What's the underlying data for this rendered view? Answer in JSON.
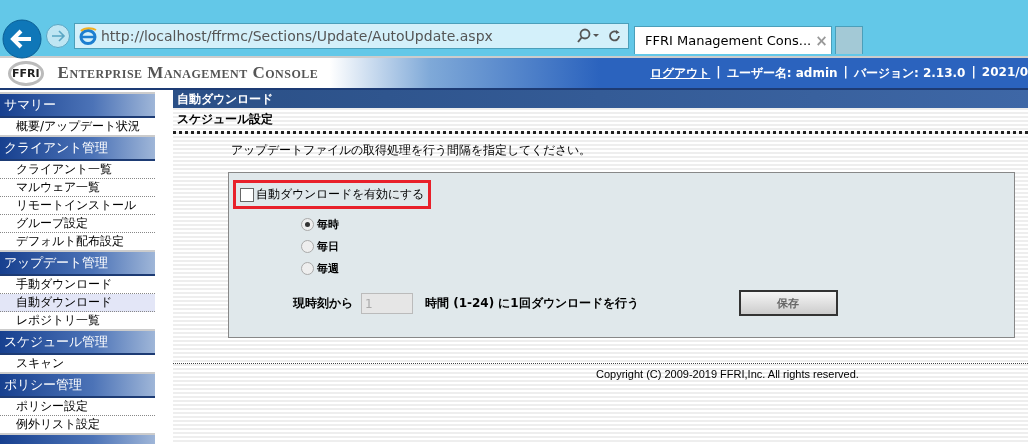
{
  "browser": {
    "url": "http://localhost/ffrmc/Sections/Update/AutoUpdate.aspx",
    "tab_title": "FFRI Management Cons...",
    "tab_close": "×"
  },
  "header": {
    "logo": "FFRI",
    "title": "Enterprise Management Console",
    "links": [
      {
        "text": "ログアウト",
        "kind": "link"
      },
      {
        "text": "|",
        "kind": "sep"
      },
      {
        "text": "ユーザー名: admin",
        "kind": "text"
      },
      {
        "text": "|",
        "kind": "sep"
      },
      {
        "text": "バージョン: 2.13.0",
        "kind": "text"
      },
      {
        "text": "|",
        "kind": "sep"
      },
      {
        "text": "2021/0",
        "kind": "text"
      }
    ]
  },
  "sidebar": {
    "sections": [
      {
        "title": "サマリー",
        "items": [
          {
            "label": "概要/アップデート状況",
            "selected": false
          }
        ]
      },
      {
        "title": "クライアント管理",
        "items": [
          {
            "label": "クライアント一覧",
            "selected": false
          },
          {
            "label": "マルウェア一覧",
            "selected": false
          },
          {
            "label": "リモートインストール",
            "selected": false
          },
          {
            "label": "グループ設定",
            "selected": false
          },
          {
            "label": "デフォルト配布設定",
            "selected": false
          }
        ]
      },
      {
        "title": "アップデート管理",
        "items": [
          {
            "label": "手動ダウンロード",
            "selected": false
          },
          {
            "label": "自動ダウンロード",
            "selected": true
          },
          {
            "label": "レポジトリ一覧",
            "selected": false
          }
        ]
      },
      {
        "title": "スケジュール管理",
        "items": [
          {
            "label": "スキャン",
            "selected": false
          }
        ]
      },
      {
        "title": "ポリシー管理",
        "items": [
          {
            "label": "ポリシー設定",
            "selected": false
          },
          {
            "label": "例外リスト設定",
            "selected": false
          }
        ]
      }
    ]
  },
  "page": {
    "title": "自動ダウンロード",
    "section": "スケジュール設定",
    "instruction": "アップデートファイルの取得処理を行う間隔を指定してください。",
    "enable": {
      "label": "自動ダウンロードを有効にする",
      "checked": false,
      "highlighted": true
    },
    "options": [
      {
        "label": "毎時",
        "selected": true,
        "disabled": true
      },
      {
        "label": "毎日",
        "selected": false,
        "disabled": true
      },
      {
        "label": "毎週",
        "selected": false,
        "disabled": true
      }
    ],
    "interval": {
      "prefix": "現時刻から",
      "value": "1",
      "suffix": "時間 (1-24) に1回ダウンロードを行う",
      "disabled": true
    },
    "save": {
      "label": "保存",
      "disabled": true
    }
  },
  "footer": {
    "copyright": "Copyright (C) 2009-2019 FFRI,Inc. All rights reserved."
  }
}
